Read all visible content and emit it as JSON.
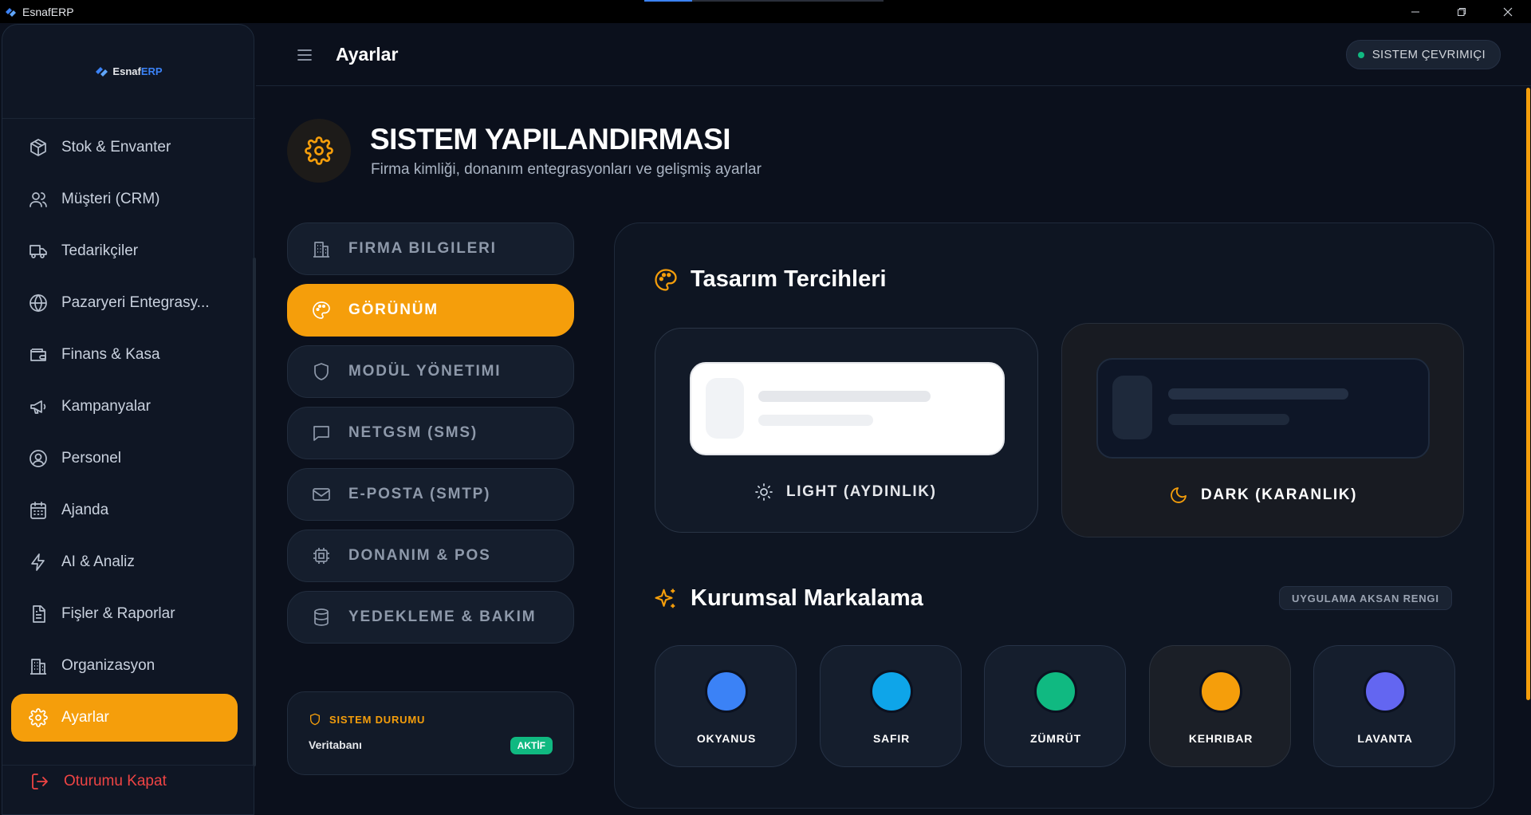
{
  "window": {
    "title": "EsnafERP",
    "progress": 0.2
  },
  "brand": {
    "name_part1": "Esnaf",
    "name_part2": "ERP"
  },
  "sidebar": {
    "items": [
      {
        "label": "Stok & Envanter",
        "icon": "package-icon"
      },
      {
        "label": "Müşteri (CRM)",
        "icon": "users-icon"
      },
      {
        "label": "Tedarikçiler",
        "icon": "truck-icon"
      },
      {
        "label": "Pazaryeri Entegrasy...",
        "icon": "globe-icon"
      },
      {
        "label": "Finans & Kasa",
        "icon": "wallet-icon"
      },
      {
        "label": "Kampanyalar",
        "icon": "megaphone-icon"
      },
      {
        "label": "Personel",
        "icon": "user-circle-icon"
      },
      {
        "label": "Ajanda",
        "icon": "calendar-icon"
      },
      {
        "label": "AI & Analiz",
        "icon": "zap-icon"
      },
      {
        "label": "Fişler & Raporlar",
        "icon": "file-text-icon"
      },
      {
        "label": "Organizasyon",
        "icon": "building-icon"
      },
      {
        "label": "Ayarlar",
        "icon": "gear-icon",
        "active": true
      }
    ],
    "logout_label": "Oturumu Kapat"
  },
  "header": {
    "title": "Ayarlar",
    "status": "SISTEM ÇEVRIMIÇI"
  },
  "hero": {
    "title": "SISTEM YAPILANDIRMASI",
    "subtitle": "Firma kimliği, donanım entegrasyonları ve gelişmiş ayarlar"
  },
  "tabs": [
    {
      "label": "FIRMA BILGILERI",
      "icon": "building-icon"
    },
    {
      "label": "GÖRÜNÜM",
      "icon": "palette-icon",
      "active": true
    },
    {
      "label": "MODÜL YÖNETIMI",
      "icon": "shield-icon"
    },
    {
      "label": "NETGSM (SMS)",
      "icon": "message-icon"
    },
    {
      "label": "E-POSTA (SMTP)",
      "icon": "mail-icon"
    },
    {
      "label": "DONANIM & POS",
      "icon": "cpu-icon"
    },
    {
      "label": "YEDEKLEME & BAKIM",
      "icon": "database-icon"
    }
  ],
  "system_status": {
    "title": "SISTEM DURUMU",
    "label": "Veritabanı",
    "badge": "AKTİF"
  },
  "design": {
    "title": "Tasarım Tercihleri",
    "light_label": "LIGHT (AYDINLIK)",
    "dark_label": "DARK (KARANLIK)"
  },
  "branding": {
    "title": "Kurumsal Markalama",
    "accent_chip": "UYGULAMA AKSAN RENGI",
    "swatches": [
      {
        "name": "OKYANUS",
        "color": "#3b82f6"
      },
      {
        "name": "SAFIR",
        "color": "#0ea5e9"
      },
      {
        "name": "ZÜMRÜT",
        "color": "#10b981"
      },
      {
        "name": "KEHRIBAR",
        "color": "#f59e0b",
        "selected": true
      },
      {
        "name": "LAVANTA",
        "color": "#6366f1"
      }
    ]
  },
  "colors": {
    "accent": "#f59e0b",
    "success": "#10b981",
    "danger": "#ef4444"
  }
}
